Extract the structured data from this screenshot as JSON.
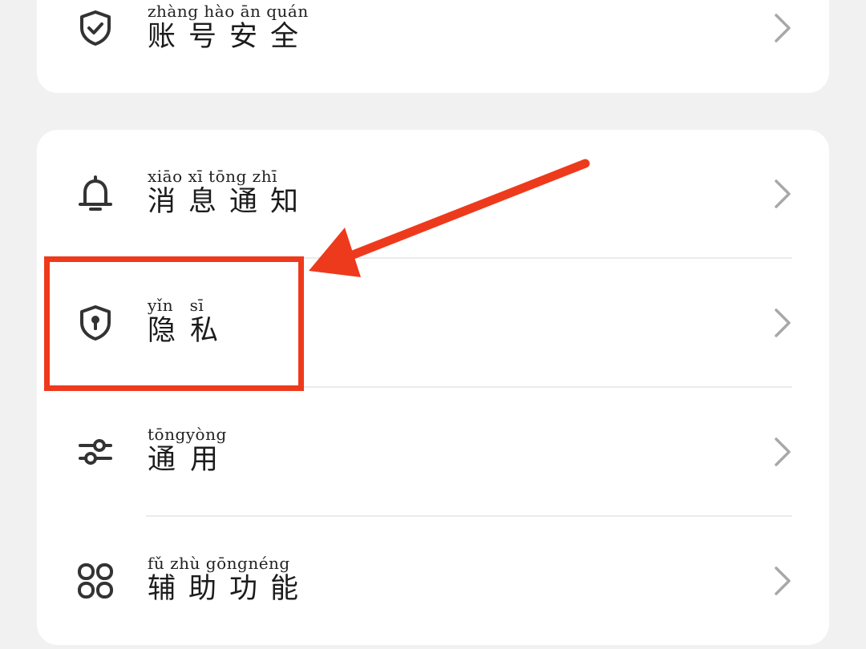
{
  "colors": {
    "background": "#f1f1f1",
    "card": "#ffffff",
    "icon": "#333333",
    "chevron": "#a8a8a8",
    "annotation": "#ee3a1c"
  },
  "account_card": {
    "items": [
      {
        "pinyin": "zhàng hào  ān quán",
        "label": "账号安全",
        "icon": "shield-check-icon"
      }
    ]
  },
  "settings_card": {
    "items": [
      {
        "pinyin": "xiāo  xī  tōng  zhī",
        "label": "消息通知",
        "icon": "bell-icon"
      },
      {
        "pinyin": "yǐn   sī",
        "label": "隐私",
        "icon": "shield-lock-icon"
      },
      {
        "pinyin": "tōngyòng",
        "label": "通用",
        "icon": "sliders-icon"
      },
      {
        "pinyin": "fǔ  zhù gōngnéng",
        "label": "辅助功能",
        "icon": "grid-icon"
      }
    ]
  },
  "annotation": {
    "highlighted_item": "隐私"
  }
}
